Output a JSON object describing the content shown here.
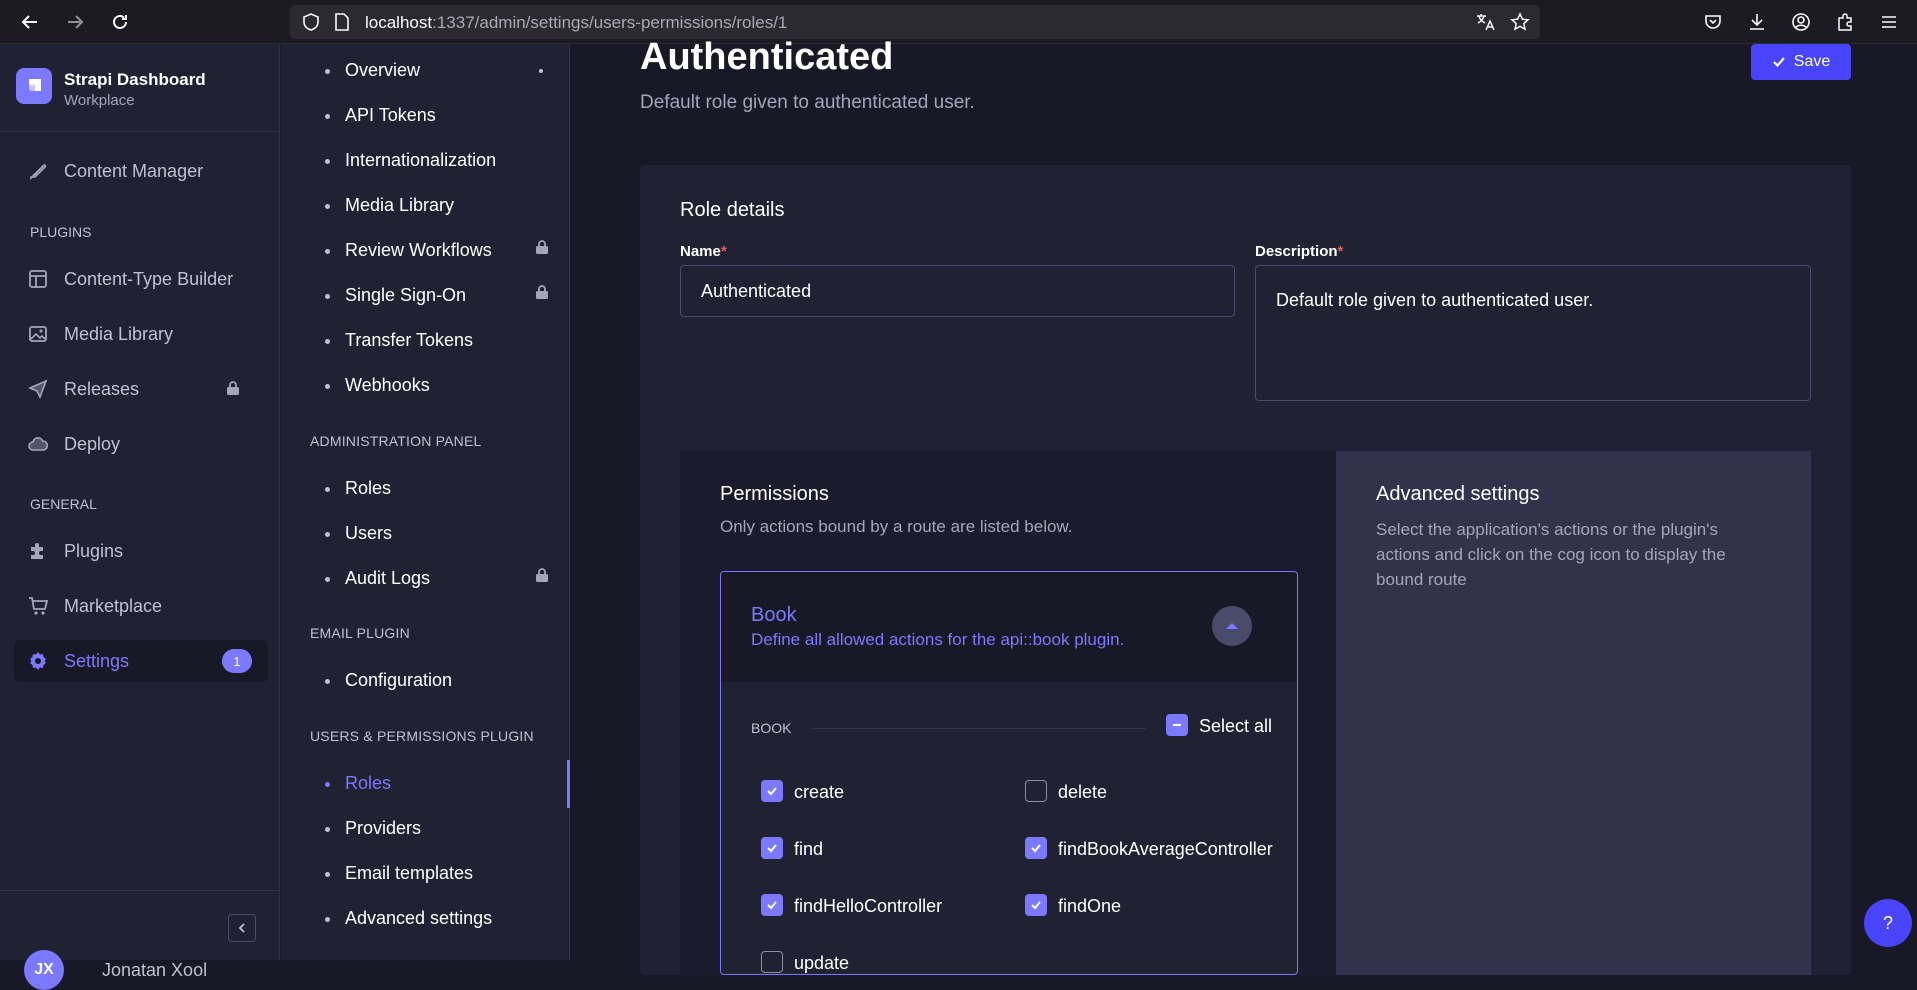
{
  "browser": {
    "url_host": "localhost",
    "url_rest": ":1337/admin/settings/users-permissions/roles/1"
  },
  "main_nav": {
    "brand_title": "Strapi Dashboard",
    "brand_subtitle": "Workplace",
    "items": [
      {
        "label": "Content Manager",
        "icon": "feather-icon"
      },
      {
        "label": "Content-Type Builder",
        "icon": "layout-icon"
      },
      {
        "label": "Media Library",
        "icon": "image-icon"
      },
      {
        "label": "Releases",
        "icon": "paper-plane-icon"
      },
      {
        "label": "Deploy",
        "icon": "cloud-icon"
      },
      {
        "label": "Plugins",
        "icon": "puzzle-icon"
      },
      {
        "label": "Marketplace",
        "icon": "cart-icon"
      },
      {
        "label": "Settings",
        "icon": "gear-icon",
        "badge": "1"
      }
    ],
    "section_plugins": "PLUGINS",
    "section_general": "GENERAL",
    "user_initials": "JX",
    "user_name": "Jonatan Xool"
  },
  "sub_nav": {
    "global_items": [
      "Overview",
      "API Tokens",
      "Internationalization",
      "Media Library",
      "Review Workflows",
      "Single Sign-On",
      "Transfer Tokens",
      "Webhooks"
    ],
    "admin_section": "ADMINISTRATION PANEL",
    "admin_items": [
      "Roles",
      "Users",
      "Audit Logs"
    ],
    "email_section": "EMAIL PLUGIN",
    "email_items": [
      "Configuration"
    ],
    "up_section": "USERS & PERMISSIONS PLUGIN",
    "up_items": [
      "Roles",
      "Providers",
      "Email templates",
      "Advanced settings"
    ]
  },
  "page": {
    "title": "Authenticated",
    "subtitle": "Default role given to authenticated user.",
    "save_label": "Save",
    "role_details": "Role details",
    "name_label": "Name",
    "name_value": "Authenticated",
    "description_label": "Description",
    "description_value": "Default role given to authenticated user.",
    "required_mark": "*"
  },
  "permissions": {
    "title": "Permissions",
    "subtitle": "Only actions bound by a route are listed below.",
    "accordion_title": "Book",
    "accordion_subtitle": "Define all allowed actions for the api::book plugin.",
    "group_label": "BOOK",
    "select_all": "Select all",
    "actions": [
      {
        "label": "create",
        "checked": true
      },
      {
        "label": "delete",
        "checked": false
      },
      {
        "label": "find",
        "checked": true
      },
      {
        "label": "findBookAverageController",
        "checked": true
      },
      {
        "label": "findHelloController",
        "checked": true
      },
      {
        "label": "findOne",
        "checked": true
      },
      {
        "label": "update",
        "checked": false
      }
    ]
  },
  "advanced": {
    "title": "Advanced settings",
    "text": "Select the application's actions or the plugin's actions and click on the cog icon to display the bound route"
  },
  "help_label": "?",
  "colors": {
    "accent": "#7b79ff",
    "primary_button": "#4945ff",
    "background": "#181826",
    "panel": "#212134"
  }
}
